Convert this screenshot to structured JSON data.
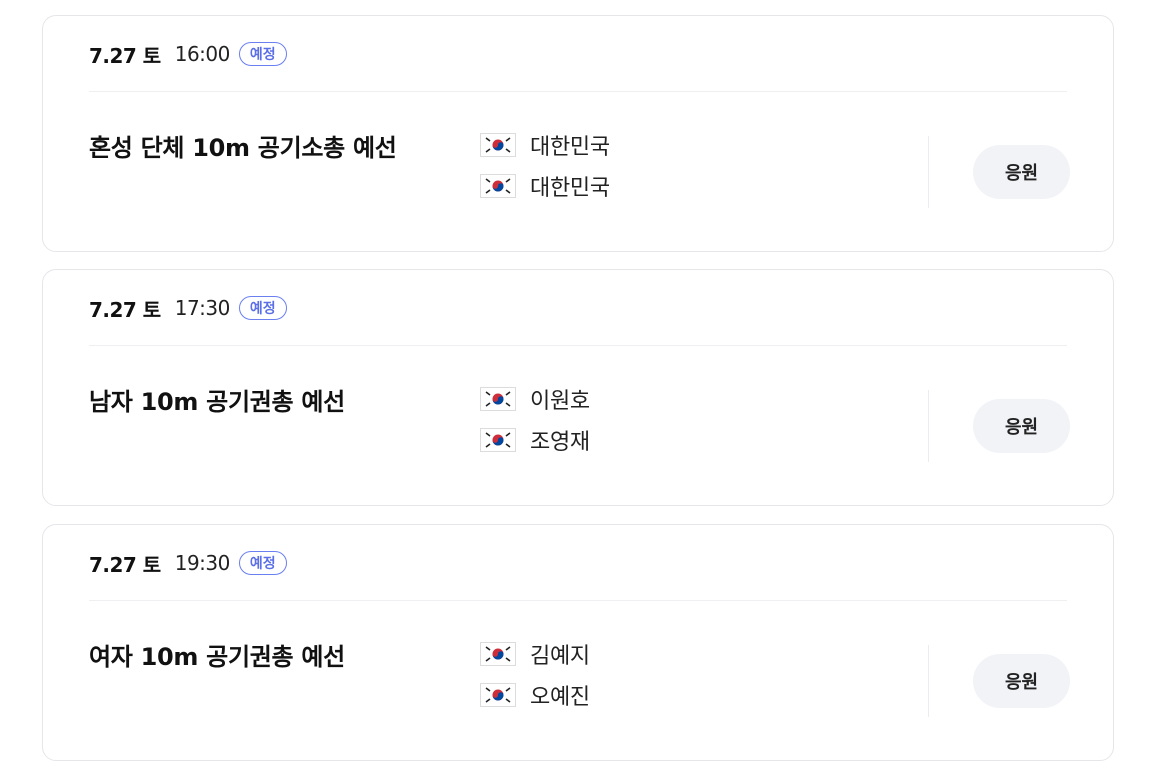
{
  "events": [
    {
      "date": "7.27 토",
      "time": "16:00",
      "status": "예정",
      "title": "혼성 단체 10m 공기소총 예선",
      "participants": [
        "대한민국",
        "대한민국"
      ],
      "cheer_label": "응원"
    },
    {
      "date": "7.27 토",
      "time": "17:30",
      "status": "예정",
      "title": "남자 10m 공기권총 예선",
      "participants": [
        "이원호",
        "조영재"
      ],
      "cheer_label": "응원"
    },
    {
      "date": "7.27 토",
      "time": "19:30",
      "status": "예정",
      "title": "여자 10m 공기권총 예선",
      "participants": [
        "김예지",
        "오예진"
      ],
      "cheer_label": "응원"
    }
  ],
  "colors": {
    "badge": "#5b6fe6",
    "card_border": "#e6e6ea",
    "cheer_bg": "#f2f3f7"
  },
  "icons": {
    "flag": "korea-flag-icon"
  }
}
